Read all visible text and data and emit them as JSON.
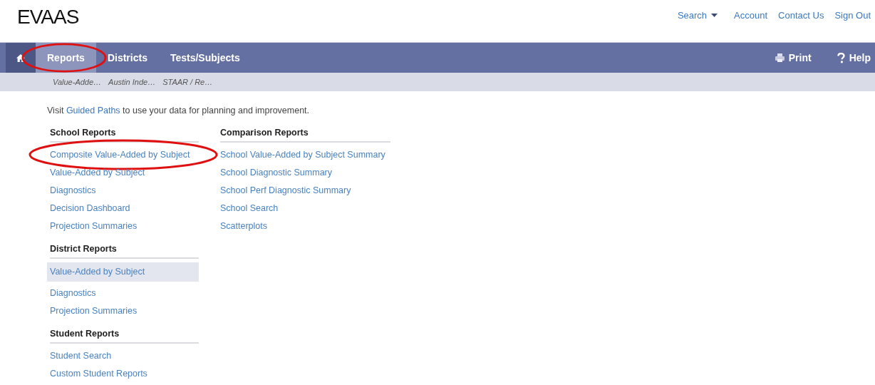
{
  "logo": "EVAAS",
  "top_links": [
    {
      "label": "Search",
      "kind": "dropdown"
    },
    {
      "label": "Account",
      "kind": "link"
    },
    {
      "label": "Contact Us",
      "kind": "link"
    },
    {
      "label": "Sign Out",
      "kind": "link"
    }
  ],
  "nav": {
    "tabs": [
      {
        "label": "Reports",
        "selected": true,
        "circled": true
      },
      {
        "label": "Districts",
        "selected": false,
        "circled": false
      },
      {
        "label": "Tests/Subjects",
        "selected": false,
        "circled": false
      }
    ],
    "actions": [
      {
        "label": "Print",
        "kind": "print"
      },
      {
        "label": "Help",
        "kind": "help"
      }
    ]
  },
  "breadcrumbs": [
    "Value-Adde…",
    "Austin Inde…",
    "STAAR / Re…"
  ],
  "intro": {
    "before": "Visit ",
    "link": "Guided Paths",
    "after": " to use your data for planning and improvement."
  },
  "columns": [
    [
      {
        "heading": "School Reports",
        "items": [
          {
            "label": "Composite Value-Added by Subject",
            "selected": false,
            "circled": true
          },
          {
            "label": "Value-Added by Subject",
            "selected": false,
            "circled": false
          },
          {
            "label": "Diagnostics",
            "selected": false,
            "circled": false
          },
          {
            "label": "Decision Dashboard",
            "selected": false,
            "circled": false
          },
          {
            "label": "Projection Summaries",
            "selected": false,
            "circled": false
          }
        ]
      },
      {
        "heading": "District Reports",
        "items": [
          {
            "label": "Value-Added by Subject",
            "selected": true,
            "circled": false
          },
          {
            "label": "Diagnostics",
            "selected": false,
            "circled": false
          },
          {
            "label": "Projection Summaries",
            "selected": false,
            "circled": false
          }
        ]
      },
      {
        "heading": "Student Reports",
        "items": [
          {
            "label": "Student Search",
            "selected": false,
            "circled": false
          },
          {
            "label": "Custom Student Reports",
            "selected": false,
            "circled": false
          }
        ]
      }
    ],
    [
      {
        "heading": "Comparison Reports",
        "items": [
          {
            "label": "School Value-Added by Subject Summary",
            "selected": false,
            "circled": false
          },
          {
            "label": "School Diagnostic Summary",
            "selected": false,
            "circled": false
          },
          {
            "label": "School Perf Diagnostic Summary",
            "selected": false,
            "circled": false
          },
          {
            "label": "School Search",
            "selected": false,
            "circled": false
          },
          {
            "label": "Scatterplots",
            "selected": false,
            "circled": false
          }
        ]
      }
    ]
  ]
}
